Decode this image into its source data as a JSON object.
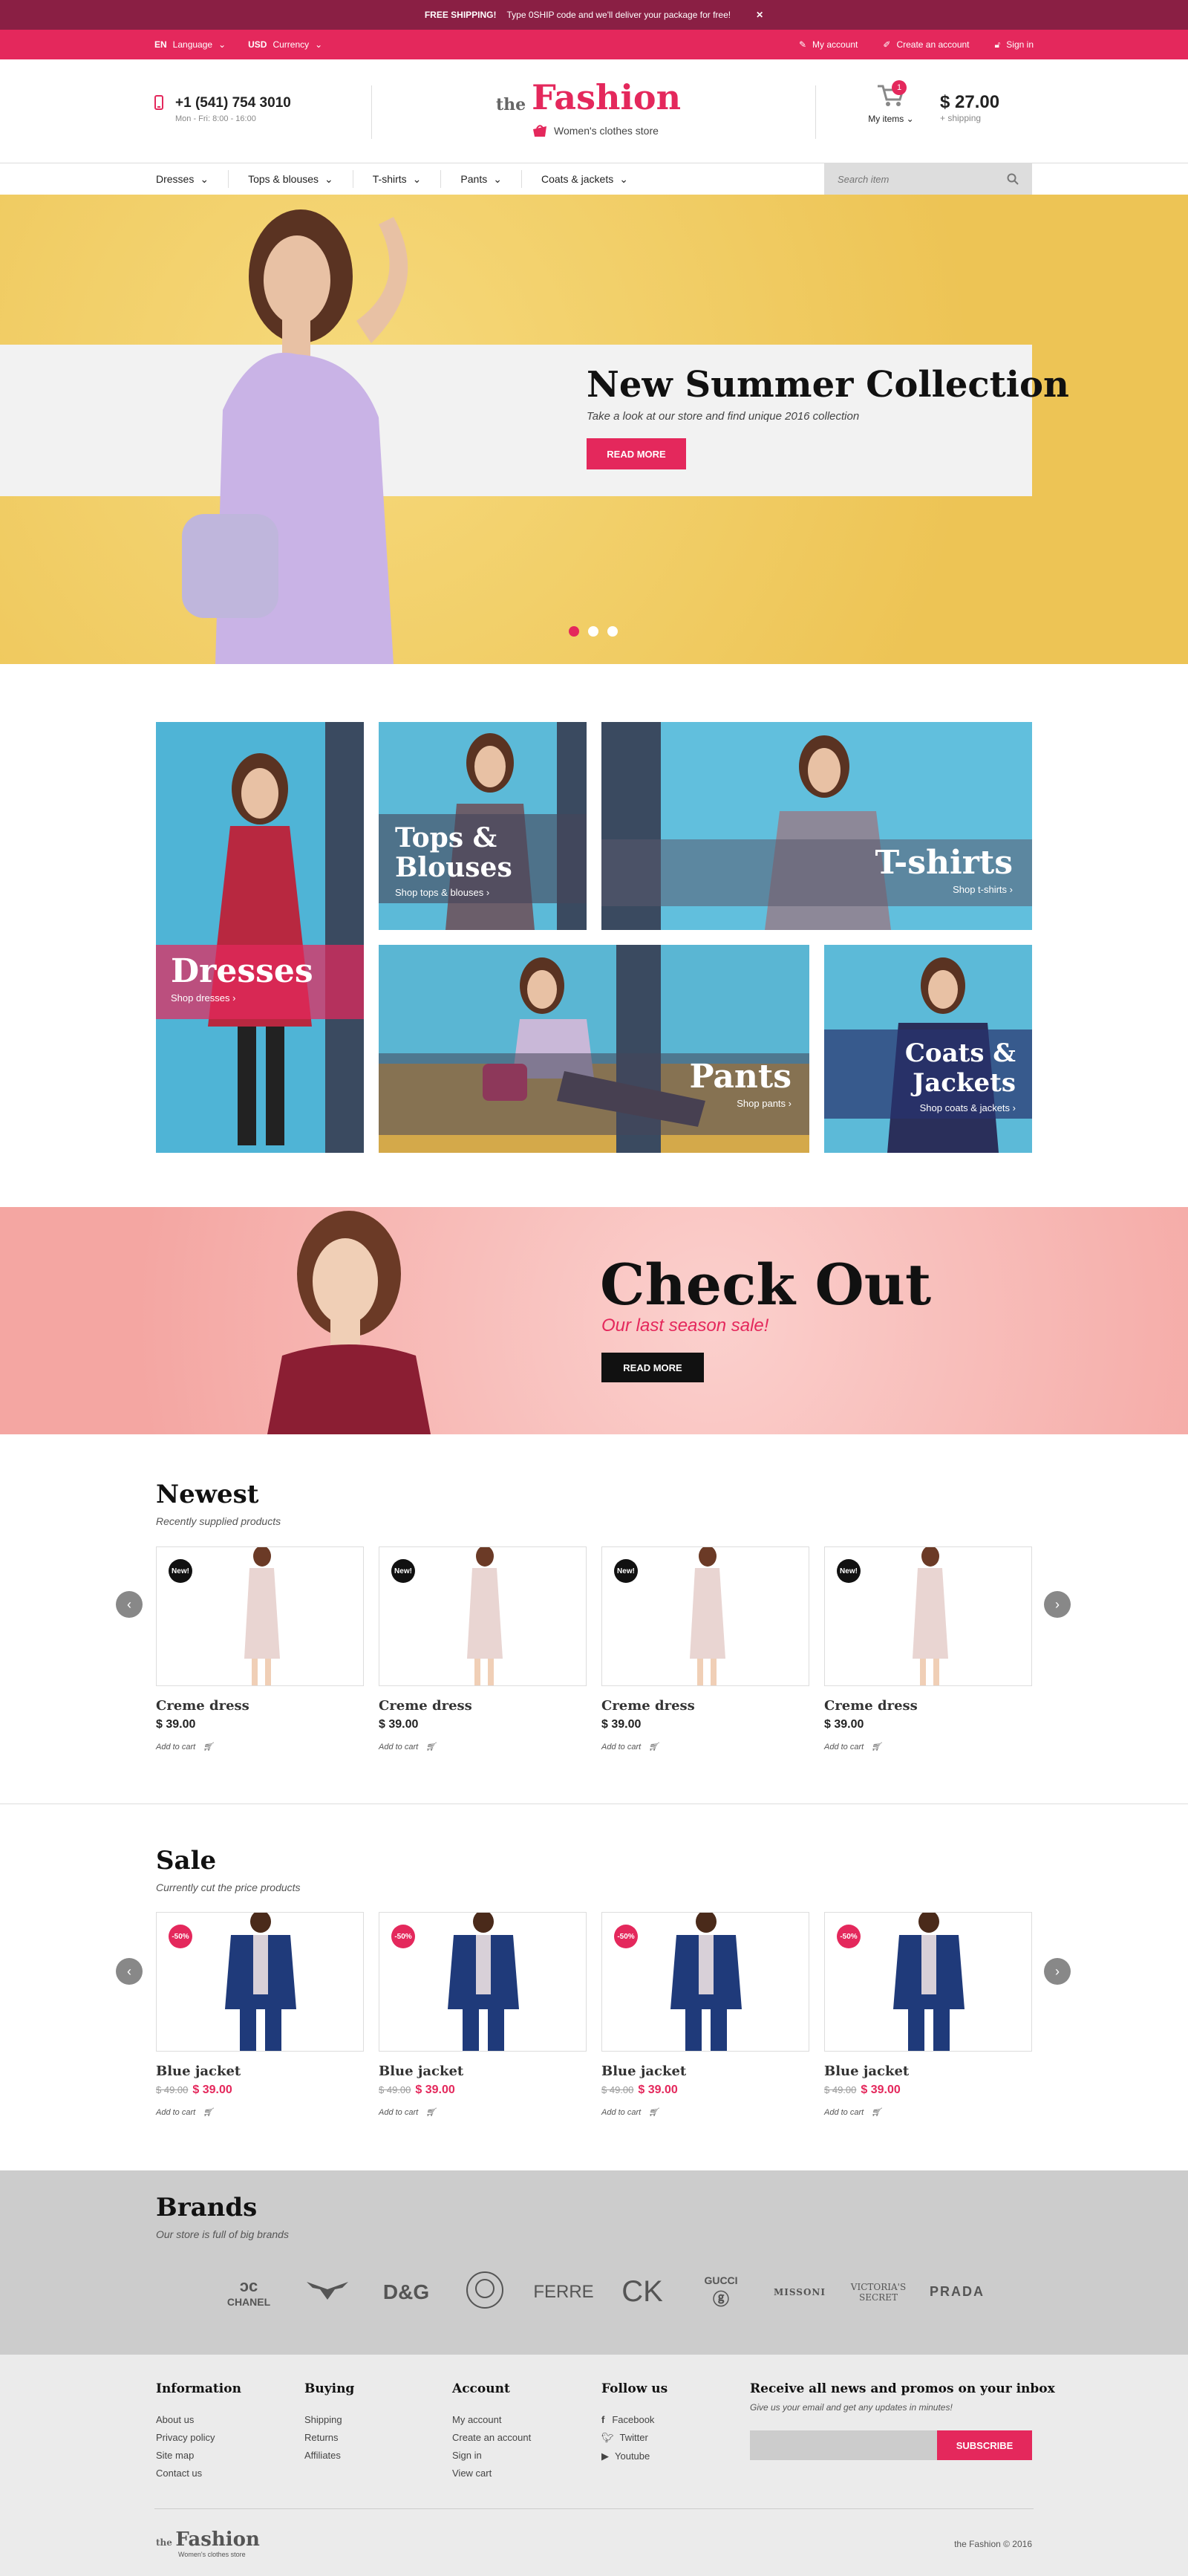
{
  "promo": {
    "strong": "FREE SHIPPING!",
    "text": "Type 0SHIP code and we'll deliver your package for free!",
    "close": "✕"
  },
  "util": {
    "lang_code": "EN",
    "lang_label": "Language",
    "cur_code": "USD",
    "cur_label": "Currency",
    "account": "My account",
    "create": "Create an account",
    "signin": "Sign in"
  },
  "header": {
    "phone": "+1 (541) 754 3010",
    "hours": "Mon - Fri: 8:00 - 16:00",
    "logo_the": "the",
    "logo_main": "Fashion",
    "logo_tag": "Women's clothes store",
    "cart_count": "1",
    "cart_label": "My items",
    "total": "$ 27.00",
    "total_sub": "+ shipping"
  },
  "nav": {
    "items": [
      "Dresses",
      "Tops & blouses",
      "T-shirts",
      "Pants",
      "Coats & jackets"
    ],
    "search_placeholder": "Search item"
  },
  "hero": {
    "title": "New Summer Collection",
    "subtitle": "Take a look at our store and find unique 2016 collection",
    "button": "READ MORE"
  },
  "categories": [
    {
      "title": "Dresses",
      "link": "Shop dresses"
    },
    {
      "title": "Tops & Blouses",
      "link": "Shop tops & blouses"
    },
    {
      "title": "T-shirts",
      "link": "Shop t-shirts"
    },
    {
      "title": "Pants",
      "link": "Shop pants"
    },
    {
      "title": "Coats & Jackets",
      "link": "Shop coats & jackets"
    }
  ],
  "checkout": {
    "title": "Check Out",
    "subtitle": "Our last season sale!",
    "button": "READ MORE"
  },
  "newest": {
    "title": "Newest",
    "subtitle": "Recently supplied products",
    "products": [
      {
        "badge": "New!",
        "name": "Creme dress",
        "price": "$ 39.00",
        "add": "Add to cart"
      },
      {
        "badge": "New!",
        "name": "Creme dress",
        "price": "$ 39.00",
        "add": "Add to cart"
      },
      {
        "badge": "New!",
        "name": "Creme dress",
        "price": "$ 39.00",
        "add": "Add to cart"
      },
      {
        "badge": "New!",
        "name": "Creme dress",
        "price": "$ 39.00",
        "add": "Add to cart"
      }
    ]
  },
  "sale": {
    "title": "Sale",
    "subtitle": "Currently cut the price products",
    "products": [
      {
        "badge": "-50%",
        "name": "Blue jacket",
        "old": "$ 49.00",
        "price": "$ 39.00",
        "add": "Add to cart"
      },
      {
        "badge": "-50%",
        "name": "Blue jacket",
        "old": "$ 49.00",
        "price": "$ 39.00",
        "add": "Add to cart"
      },
      {
        "badge": "-50%",
        "name": "Blue jacket",
        "old": "$ 49.00",
        "price": "$ 39.00",
        "add": "Add to cart"
      },
      {
        "badge": "-50%",
        "name": "Blue jacket",
        "old": "$ 49.00",
        "price": "$ 39.00",
        "add": "Add to cart"
      }
    ]
  },
  "brands": {
    "title": "Brands",
    "subtitle": "Our store is full of big brands",
    "list": [
      "CHANEL",
      "ARMANI",
      "D&G",
      "VERSACE",
      "FERRE",
      "CK",
      "GUCCI",
      "MISSONI",
      "VICTORIA'S SECRET",
      "PRADA"
    ]
  },
  "footer": {
    "cols": [
      {
        "title": "Information",
        "links": [
          "About us",
          "Privacy policy",
          "Site map",
          "Contact us"
        ]
      },
      {
        "title": "Buying",
        "links": [
          "Shipping",
          "Returns",
          "Affiliates"
        ]
      },
      {
        "title": "Account",
        "links": [
          "My account",
          "Create an account",
          "Sign in",
          "View cart"
        ]
      },
      {
        "title": "Follow us",
        "links": [
          "Facebook",
          "Twitter",
          "Youtube"
        ]
      }
    ],
    "news_title": "Receive all news and promos on your inbox",
    "news_sub": "Give us your email and get any updates in minutes!",
    "subscribe": "SUBSCRIBE",
    "copyright": "the Fashion © 2016"
  },
  "colors": {
    "accent": "#e4285c",
    "promo": "#8a1f44",
    "brands_bg": "#cccccc",
    "footer_bg": "#ebebeb"
  }
}
